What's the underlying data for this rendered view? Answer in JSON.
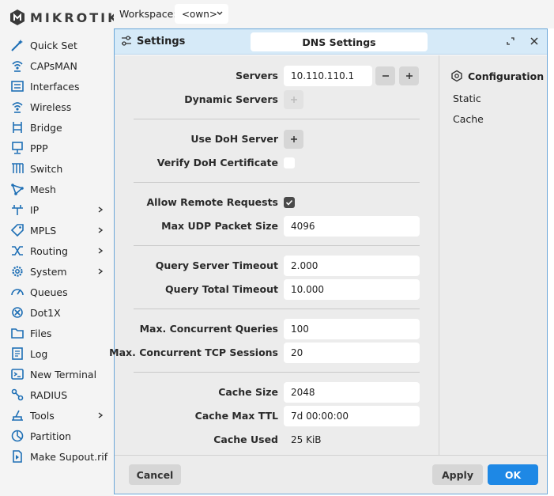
{
  "brand": {
    "logo_text": "MIKROTIK"
  },
  "topbar": {
    "workspace_label": "Workspace:",
    "workspace_value": "<own>"
  },
  "sidebar": {
    "items": [
      {
        "label": "Quick Set",
        "icon": "wand-icon",
        "submenu": false
      },
      {
        "label": "CAPsMAN",
        "icon": "wireless-icon",
        "submenu": false
      },
      {
        "label": "Interfaces",
        "icon": "interfaces-icon",
        "submenu": false
      },
      {
        "label": "Wireless",
        "icon": "wireless-icon",
        "submenu": false
      },
      {
        "label": "Bridge",
        "icon": "bridge-icon",
        "submenu": false
      },
      {
        "label": "PPP",
        "icon": "ppp-icon",
        "submenu": false
      },
      {
        "label": "Switch",
        "icon": "switch-icon",
        "submenu": false
      },
      {
        "label": "Mesh",
        "icon": "mesh-icon",
        "submenu": false
      },
      {
        "label": "IP",
        "icon": "ip-icon",
        "submenu": true
      },
      {
        "label": "MPLS",
        "icon": "tag-icon",
        "submenu": true
      },
      {
        "label": "Routing",
        "icon": "routing-icon",
        "submenu": true
      },
      {
        "label": "System",
        "icon": "gear-icon",
        "submenu": true
      },
      {
        "label": "Queues",
        "icon": "gauge-icon",
        "submenu": false
      },
      {
        "label": "Dot1X",
        "icon": "dot1x-icon",
        "submenu": false
      },
      {
        "label": "Files",
        "icon": "folder-icon",
        "submenu": false
      },
      {
        "label": "Log",
        "icon": "log-icon",
        "submenu": false
      },
      {
        "label": "New Terminal",
        "icon": "terminal-icon",
        "submenu": false
      },
      {
        "label": "RADIUS",
        "icon": "radius-icon",
        "submenu": false
      },
      {
        "label": "Tools",
        "icon": "tools-icon",
        "submenu": true
      },
      {
        "label": "Partition",
        "icon": "partition-icon",
        "submenu": false
      },
      {
        "label": "Make Supout.rif",
        "icon": "play-file-icon",
        "submenu": false
      }
    ]
  },
  "dialog": {
    "title": "Settings",
    "tab": "DNS Settings",
    "fields": {
      "servers": {
        "label": "Servers",
        "value": "10.110.110.1"
      },
      "dynamic_servers": {
        "label": "Dynamic Servers"
      },
      "use_doh_server": {
        "label": "Use DoH Server"
      },
      "verify_doh_cert": {
        "label": "Verify DoH Certificate",
        "checked": false
      },
      "allow_remote": {
        "label": "Allow Remote Requests",
        "checked": true
      },
      "max_udp": {
        "label": "Max UDP Packet Size",
        "value": "4096"
      },
      "query_server_timeout": {
        "label": "Query Server Timeout",
        "value": "2.000"
      },
      "query_total_timeout": {
        "label": "Query Total Timeout",
        "value": "10.000"
      },
      "max_concurrent_queries": {
        "label": "Max. Concurrent Queries",
        "value": "100"
      },
      "max_concurrent_tcp": {
        "label": "Max. Concurrent TCP Sessions",
        "value": "20"
      },
      "cache_size": {
        "label": "Cache Size",
        "value": "2048"
      },
      "cache_max_ttl": {
        "label": "Cache Max TTL",
        "value": "7d 00:00:00"
      },
      "cache_used": {
        "label": "Cache Used",
        "value": "25 KiB"
      }
    },
    "side": {
      "heading": "Configuration",
      "links": [
        "Static",
        "Cache"
      ]
    },
    "buttons": {
      "cancel": "Cancel",
      "apply": "Apply",
      "ok": "OK"
    }
  },
  "colors": {
    "accent": "#1e88e5",
    "header_bg": "#d6eaf8",
    "body_bg": "#ececec",
    "sidebar_bg": "#f4f4f4"
  }
}
